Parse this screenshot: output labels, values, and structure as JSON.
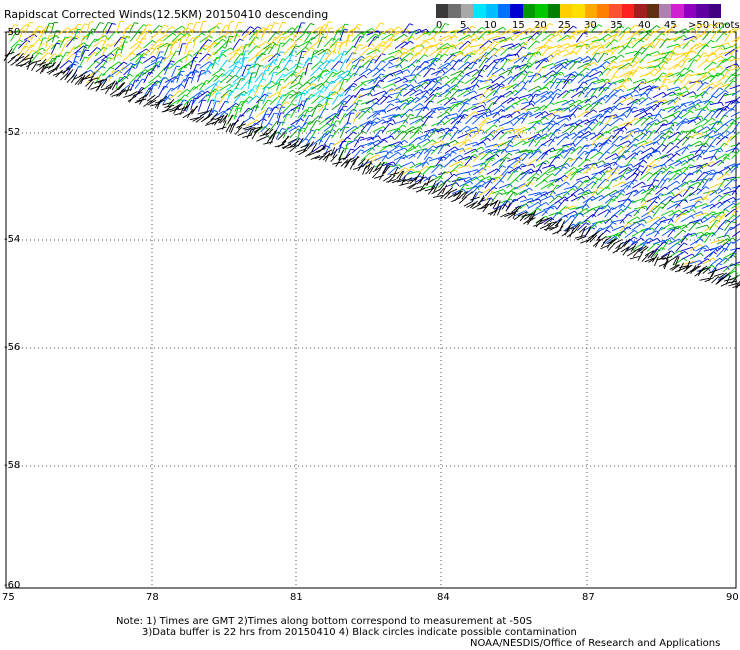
{
  "title": "Rapidscat Corrected Winds(12.5KM) 20150410 descending",
  "legend": {
    "unit": ">50 knots",
    "ticks": [
      "0",
      "5",
      "10",
      "15",
      "20",
      "25",
      "30",
      "35",
      "40",
      "45",
      ">50 knots"
    ],
    "colors": [
      "#3a3a3a",
      "#707070",
      "#a8a8a8",
      "#00e5ff",
      "#00bfff",
      "#0070ff",
      "#0000d0",
      "#009a00",
      "#00c800",
      "#008000",
      "#ffd000",
      "#ffe000",
      "#ffaa00",
      "#ff8000",
      "#ff5030",
      "#ff2020",
      "#a02020",
      "#603010",
      "#b080b0",
      "#d020d0",
      "#9000c0",
      "#6000a0",
      "#400080"
    ]
  },
  "axes": {
    "lat_labels": [
      "-50",
      "-52",
      "-54",
      "-56",
      "-58",
      "-60"
    ],
    "lon_labels": [
      "75",
      "78",
      "81",
      "84",
      "87",
      "90"
    ]
  },
  "notes": {
    "line1": "Note: 1) Times are GMT 2)Times along bottom correspond to measurement at -50S",
    "line2": "3)Data buffer is 22 hrs from 20150410 4) Black circles indicate possible contamination",
    "credit": "NOAA/NESDIS/Office of Research and Applications"
  },
  "swath": {
    "orbit": "descending",
    "dominant_speed_knots": "10-20",
    "edge_flag_color": "#000000"
  }
}
